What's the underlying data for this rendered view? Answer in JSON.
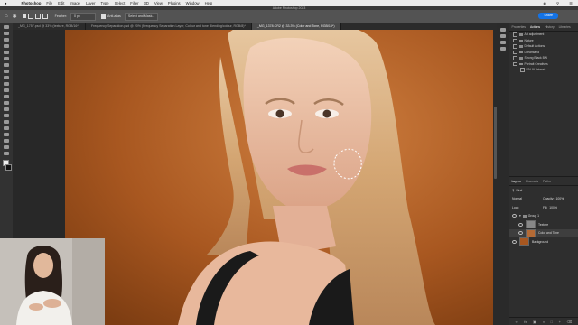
{
  "menubar": {
    "app": "Photoshop",
    "items": [
      "File",
      "Edit",
      "Image",
      "Layer",
      "Type",
      "Select",
      "Filter",
      "3D",
      "View",
      "Plugins",
      "Window",
      "Help"
    ]
  },
  "window_title": "Adobe Photoshop 2023",
  "options": {
    "feather_label": "Feather:",
    "feather_value": "0 px",
    "anti_alias": "Anti-alias",
    "select_mask": "Select and Mask...",
    "share": "Share"
  },
  "tabs": [
    {
      "label": "_MG_1757.psd @ 33% (texture, RGB/16*)"
    },
    {
      "label": "Frequency Separation.psd @ 20% (Frequency Separation Layer, Colour and tone Blending/colour, RGB/8)*"
    },
    {
      "label": "_MG_1378.CR2 @ 33.3% (Color and Tone, RGB/16*)"
    }
  ],
  "panel_tabs": [
    "Properties",
    "Actions",
    "History",
    "Libraries"
  ],
  "actions": [
    {
      "label": "Art adjustment"
    },
    {
      "label": "Nature"
    },
    {
      "label": "Default Actions"
    },
    {
      "label": "Dreamland"
    },
    {
      "label": "Strong Black BW"
    },
    {
      "label": "Portrait Creatives"
    },
    {
      "label": "F9 UV Artwork"
    }
  ],
  "layers_tabs": [
    "Layers",
    "Channels",
    "Paths"
  ],
  "layers": {
    "kind": "Kind",
    "mode": "Normal",
    "opacity_label": "Opacity:",
    "opacity": "100%",
    "lock_label": "Lock:",
    "fill_label": "Fill:",
    "fill": "100%",
    "items": [
      {
        "name": "Group 1"
      },
      {
        "name": "Texture"
      },
      {
        "name": "Color and Tone"
      },
      {
        "name": "Background"
      }
    ]
  },
  "colors": {
    "backdrop": "#a9581f",
    "accent": "#1473e6"
  }
}
